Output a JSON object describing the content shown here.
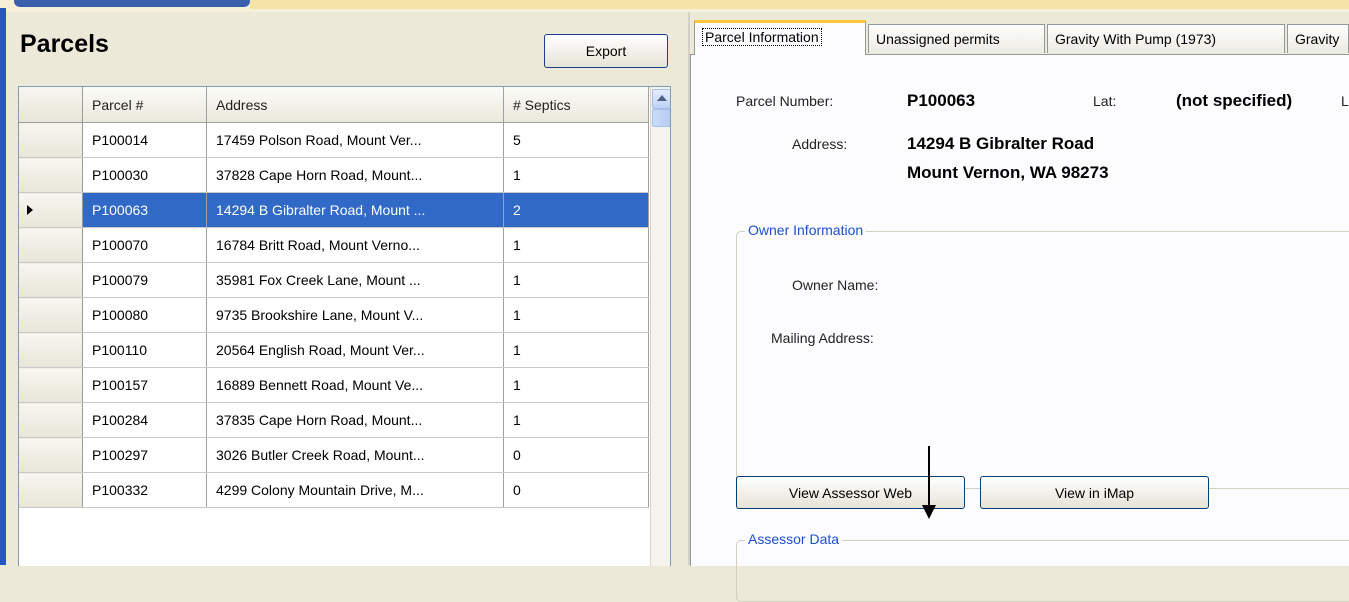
{
  "parcels_panel": {
    "title": "Parcels",
    "export_label": "Export",
    "columns": [
      "Parcel #",
      "Address",
      "# Septics"
    ],
    "rows": [
      {
        "parcel": "P100014",
        "address": "17459 Polson Road, Mount Ver...",
        "septics": "5"
      },
      {
        "parcel": "P100030",
        "address": "37828 Cape Horn Road, Mount...",
        "septics": "1"
      },
      {
        "parcel": "P100063",
        "address": "14294 B Gibralter Road, Mount ...",
        "septics": "2"
      },
      {
        "parcel": "P100070",
        "address": "16784 Britt Road, Mount Verno...",
        "septics": "1"
      },
      {
        "parcel": "P100079",
        "address": "35981 Fox Creek Lane, Mount ...",
        "septics": "1"
      },
      {
        "parcel": "P100080",
        "address": "9735 Brookshire Lane, Mount V...",
        "septics": "1"
      },
      {
        "parcel": "P100110",
        "address": "20564 English Road, Mount Ver...",
        "septics": "1"
      },
      {
        "parcel": "P100157",
        "address": "16889 Bennett Road, Mount Ve...",
        "septics": "1"
      },
      {
        "parcel": "P100284",
        "address": "37835 Cape Horn Road, Mount...",
        "septics": "1"
      },
      {
        "parcel": "P100297",
        "address": "3026 Butler Creek Road, Mount...",
        "septics": "0"
      },
      {
        "parcel": "P100332",
        "address": "4299 Colony Mountain Drive, M...",
        "septics": "0"
      }
    ],
    "selected_row_index": 2
  },
  "tabs": [
    "Parcel Information",
    "Unassigned permits",
    "Gravity With Pump (1973)",
    "Gravity"
  ],
  "details": {
    "parcel_number_label": "Parcel Number:",
    "parcel_number": "P100063",
    "lat_label": "Lat:",
    "lat_value": "(not specified)",
    "lon_label_partial": "L",
    "address_label": "Address:",
    "address_line1": "14294 B Gibralter Road",
    "address_line2": "Mount Vernon, WA 98273",
    "owner_group_title": "Owner Information",
    "owner_name_label": "Owner Name:",
    "mailing_address_label": "Mailing Address:",
    "view_assessor_label": "View Assessor Web",
    "view_imap_label": "View in iMap",
    "assessor_group_title": "Assessor Data"
  },
  "colors": {
    "selection": "#3169c6",
    "group_title": "#1c4fd1",
    "active_tab_accent": "#ffc73c"
  }
}
